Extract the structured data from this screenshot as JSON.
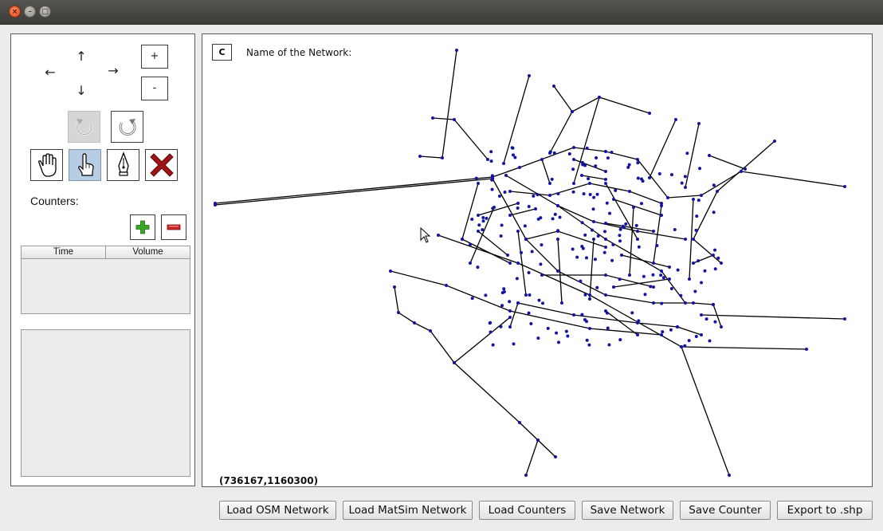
{
  "window": {
    "controls": [
      {
        "name": "close",
        "glyph": "×"
      },
      {
        "name": "minimize",
        "glyph": "–"
      },
      {
        "name": "maximize",
        "glyph": "□"
      }
    ]
  },
  "navigation": {
    "up": "↑",
    "down": "↓",
    "left": "←",
    "right": "→",
    "zoom_in": "+",
    "zoom_out": "-"
  },
  "tools": [
    {
      "name": "undo",
      "icon": "undo-icon",
      "state": "disabled"
    },
    {
      "name": "redo",
      "icon": "redo-icon",
      "state": "enabled"
    },
    {
      "name": "pan",
      "icon": "hand-icon",
      "state": "enabled"
    },
    {
      "name": "select",
      "icon": "pointer-hand-icon",
      "state": "active"
    },
    {
      "name": "draw",
      "icon": "pen-icon",
      "state": "enabled"
    },
    {
      "name": "delete",
      "icon": "red-x-icon",
      "state": "enabled"
    }
  ],
  "counters": {
    "label": "Counters:",
    "add_icon": "green-plus-icon",
    "remove_icon": "red-minus-icon",
    "table": {
      "columns": [
        "Time",
        "Volume"
      ],
      "rows": []
    }
  },
  "map": {
    "c_button": "C",
    "network_name_label": "Name of the Network:",
    "coordinates": "(736167,1160300)",
    "node_color": "#1414a0",
    "edge_color": "#000000"
  },
  "actions": {
    "load_osm": "Load OSM Network",
    "load_matsim": "Load MatSim Network",
    "load_counters": "Load Counters",
    "save_network": "Save Network",
    "save_counter": "Save Counter",
    "export_shp": "Export to .shp"
  },
  "colors": {
    "delete_red": "#a01414",
    "active_tool": "#b7cde4",
    "add_green": "#3aa526",
    "remove_red": "#cf2020"
  }
}
